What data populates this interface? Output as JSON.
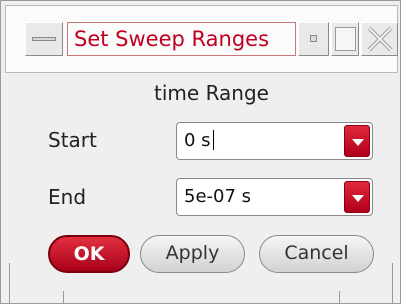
{
  "window": {
    "title": "Set Sweep Ranges"
  },
  "section": {
    "title": "time Range"
  },
  "fields": {
    "start": {
      "label": "Start",
      "value": "0 s"
    },
    "end": {
      "label": "End",
      "value": "5e-07 s"
    }
  },
  "buttons": {
    "ok": "OK",
    "apply": "Apply",
    "cancel": "Cancel"
  },
  "icons": {
    "window_menu": "window-menu-icon",
    "minimize": "minimize-icon",
    "maximize": "maximize-icon",
    "close": "close-icon",
    "dropdown": "chevron-down-icon"
  },
  "colors": {
    "title_text": "#c0001f",
    "accent": "#c8102e"
  }
}
